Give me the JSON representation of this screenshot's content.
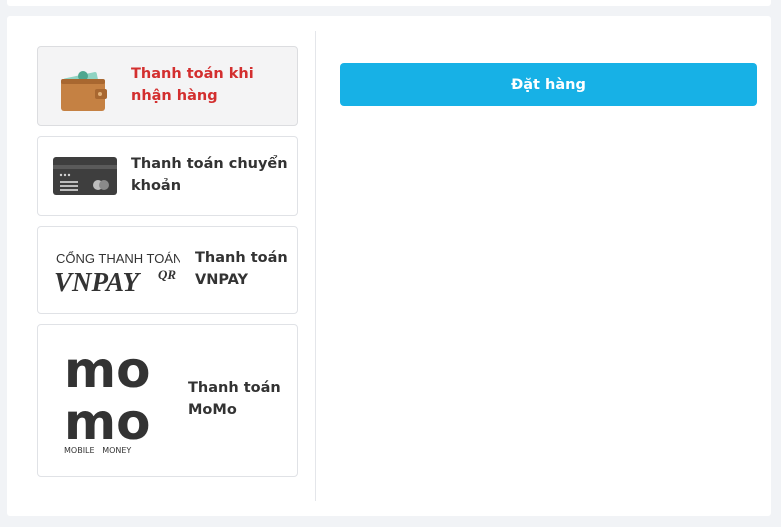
{
  "payment": {
    "methods": [
      {
        "label": "Thanh toán khi nhận hàng",
        "icon": "wallet-icon",
        "selected": true
      },
      {
        "label": "Thanh toán chuyển khoản",
        "icon": "bank-card-icon",
        "selected": false
      },
      {
        "label": "Thanh toán VNPAY",
        "icon": "vnpay-logo",
        "selected": false
      },
      {
        "label": "Thanh toán MoMo",
        "icon": "momo-logo",
        "selected": false
      }
    ],
    "vnpay_logo": {
      "top": "CỔNG THANH TOÁN",
      "main": "VNPAY",
      "sup": "QR"
    },
    "momo_logo": {
      "line1": "mo",
      "line2": "mo",
      "caption": "MOBILE   MONEY"
    }
  },
  "order": {
    "button_label": "Đặt hàng"
  },
  "colors": {
    "accent": "#17b1e6",
    "selected_text": "#d32f2f",
    "text": "#333333",
    "border": "#e0e2e6"
  }
}
